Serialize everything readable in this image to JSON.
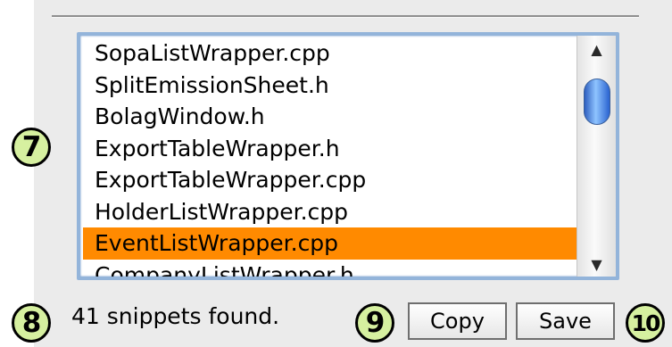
{
  "callouts": {
    "list": "7",
    "status": "8",
    "copy": "9",
    "save": "10"
  },
  "file_list": {
    "items": [
      {
        "label": "SopaListWrapper.cpp",
        "selected": false
      },
      {
        "label": "SplitEmissionSheet.h",
        "selected": false
      },
      {
        "label": "BolagWindow.h",
        "selected": false
      },
      {
        "label": "ExportTableWrapper.h",
        "selected": false
      },
      {
        "label": "ExportTableWrapper.cpp",
        "selected": false
      },
      {
        "label": "HolderListWrapper.cpp",
        "selected": false
      },
      {
        "label": "EventListWrapper.cpp",
        "selected": true
      },
      {
        "label": "CompanyListWrapper.h",
        "selected": false
      }
    ],
    "selection_color": "#ff8a00",
    "focus_ring_color": "#93b4da"
  },
  "status": {
    "text": "41 snippets found."
  },
  "buttons": {
    "copy_label": "Copy",
    "save_label": "Save"
  },
  "icons": {
    "scroll_up": "▲",
    "scroll_down": "▼"
  }
}
